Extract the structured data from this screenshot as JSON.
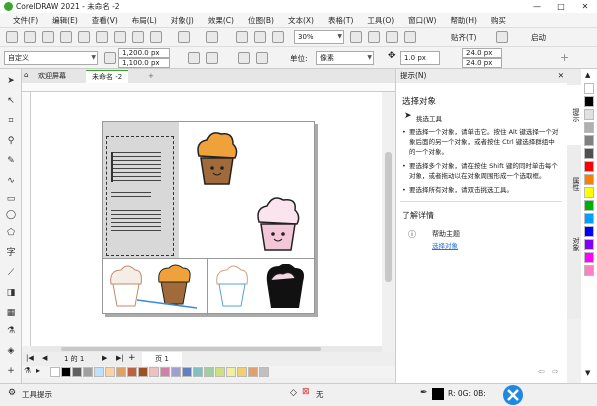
{
  "titlebar": {
    "title": "CorelDRAW 2021 - 未命名 -2",
    "min": "—",
    "max": "□",
    "close": "✕"
  },
  "menu": [
    "文件(F)",
    "编辑(E)",
    "查看(V)",
    "布局(L)",
    "对象(J)",
    "效果(C)",
    "位图(B)",
    "文本(X)",
    "表格(T)",
    "工具(O)",
    "窗口(W)",
    "帮助(H)",
    "购买"
  ],
  "stdbar": {
    "zoom": "30%",
    "snap": "贴齐(T)",
    "launch": "启动"
  },
  "propbar": {
    "preset": "自定义",
    "width": "1,200.0 px",
    "height": "1,100.0 px",
    "units_label": "单位:",
    "units": "像素",
    "nudge": "1.0 px",
    "dup_x": "24.0 px",
    "dup_y": "24.0 px"
  },
  "tabs": {
    "welcome": "欢迎屏幕",
    "doc": "未命名 -2",
    "add": "+"
  },
  "pagenav": {
    "page_of": "1 的 1",
    "page_tab": "页 1"
  },
  "docker": {
    "header": "提示(N)",
    "section_title": "选择对象",
    "tool_label": "挑选工具",
    "tips": [
      "要选择一个对象，请单击它。按住 Alt 键选择一个对象后面的另一个对象，或者按住 Ctrl 键选择群组中的一个对象。",
      "要选择多个对象，请在按住 Shift 键的同时单击每个对象，或者拖动以在对象周围形成一个选取框。",
      "要选择所有对象，请双击挑选工具。"
    ],
    "more_title": "了解详情",
    "help_title": "帮助主题",
    "help_link": "选择对象"
  },
  "docker_tabs": [
    "提示",
    "属性",
    "对象"
  ],
  "status": {
    "hint": "工具提示",
    "fill_none": "无",
    "color_readout": "R: 0G: 0B:"
  },
  "colors": {
    "accent": "#3aa62e",
    "link": "#2a6fd6",
    "palette": [
      "#ffffff",
      "#000000",
      "#e0e0e0",
      "#b0b0b0",
      "#808080",
      "#505050",
      "#ff0000",
      "#ff7f00",
      "#ffff00",
      "#00b000",
      "#00a0ff",
      "#0000ff",
      "#8000ff",
      "#ff00ff",
      "#ff80c0"
    ],
    "bottom_palette": [
      "#ffffff",
      "#000000",
      "#606060",
      "#a0a0a0",
      "#c0e0ff",
      "#ffd0a0",
      "#e0a060",
      "#c06040",
      "#a05020",
      "#f0c0c0",
      "#d080a0",
      "#a0a0d0",
      "#6080c0",
      "#80c0c0",
      "#a0d0a0",
      "#d0e080",
      "#f0f0a0",
      "#f0d070",
      "#e0a070",
      "#c0c0c0"
    ]
  }
}
